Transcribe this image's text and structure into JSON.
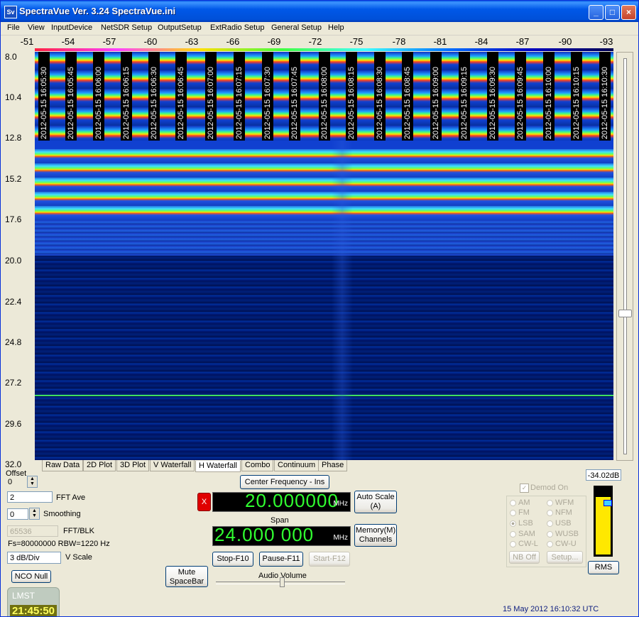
{
  "window": {
    "title": "SpectraVue Ver. 3.24  SpectraVue.ini",
    "icon": "Sv",
    "controls": {
      "minimize": "_",
      "maximize": "□",
      "close": "×"
    }
  },
  "menu": [
    "File",
    "View",
    "InputDevice",
    "NetSDR Setup",
    "OutputSetup",
    "ExtRadio Setup",
    "General Setup",
    "Help"
  ],
  "scale_labels": [
    "-51",
    "-54",
    "-57",
    "-60",
    "-63",
    "-66",
    "-69",
    "-72",
    "-75",
    "-78",
    "-81",
    "-84",
    "-87",
    "-90",
    "-93"
  ],
  "y_axis_labels": [
    "8.0",
    "10.4",
    "12.8",
    "15.2",
    "17.6",
    "20.0",
    "22.4",
    "24.8",
    "27.2",
    "29.6",
    "32.0"
  ],
  "timestamps": [
    "2012-05-15 16:05:30",
    "2012-05-15 16:05:45",
    "2012-05-15 16:06:00",
    "2012-05-15 16:06:15",
    "2012-05-15 16:06:30",
    "2012-05-15 16:06:45",
    "2012-05-15 16:07:00",
    "2012-05-15 16:07:15",
    "2012-05-15 16:07:30",
    "2012-05-15 16:07:45",
    "2012-05-15 16:08:00",
    "2012-05-15 16:08:15",
    "2012-05-15 16:08:30",
    "2012-05-15 16:08:45",
    "2012-05-15 16:09:00",
    "2012-05-15 16:09:15",
    "2012-05-15 16:09:30",
    "2012-05-15 16:09:45",
    "2012-05-15 16:10:00",
    "2012-05-15 16:10:15",
    "2012-05-15 16:10:30"
  ],
  "tabs": {
    "raw": "Raw Data",
    "plot2d": "2D Plot",
    "plot3d": "3D Plot",
    "vwf": "V Waterfall",
    "hwf": "H Waterfall",
    "combo": "Combo",
    "continuum": "Continuum",
    "phase": "Phase"
  },
  "controls": {
    "offset_label": "Offset",
    "offset_value": "0",
    "fft_ave_value": "2",
    "fft_ave_label": "FFT Ave",
    "smoothing_value": "0",
    "smoothing_label": "Smoothing",
    "fft_blk_value": "65536",
    "fft_blk_label": "FFT/BLK",
    "fs_rbw": "Fs=80000000 RBW=1220 Hz",
    "vscale_value": "3 dB/Div",
    "vscale_label": "V Scale",
    "nco_null": "NCO Null",
    "mute": "Mute\nSpaceBar",
    "center_freq_button": "Center Frequency - Ins",
    "center_freq_value": "20.000000",
    "center_freq_unit": "MHz",
    "auto_scale": "Auto Scale\n(A)",
    "span_label": "Span",
    "span_value": "24.000 000",
    "span_unit": "MHz",
    "memory": "Memory(M)\nChannels",
    "stop": "Stop-F10",
    "pause": "Pause-F11",
    "start": "Start-F12",
    "audio_volume": "Audio Volume",
    "x_icon": "X"
  },
  "demod": {
    "label": "Demod On",
    "modes": [
      "AM",
      "WFM",
      "FM",
      "NFM",
      "LSB",
      "USB",
      "SAM",
      "WUSB",
      "CW-L",
      "CW-U"
    ],
    "selected": "LSB",
    "nb_off": "NB Off",
    "setup": "Setup..."
  },
  "meter": {
    "db_readout": "-34.02dB",
    "rms": "RMS",
    "level": 0.85
  },
  "status": {
    "lmst_label": "LMST",
    "lmst_time": "21:45:50",
    "date_time": "15 May 2012  16:10:32 UTC"
  },
  "colors": {
    "waterfall_bg": "#001060",
    "freq_digits": "#30ff30"
  }
}
